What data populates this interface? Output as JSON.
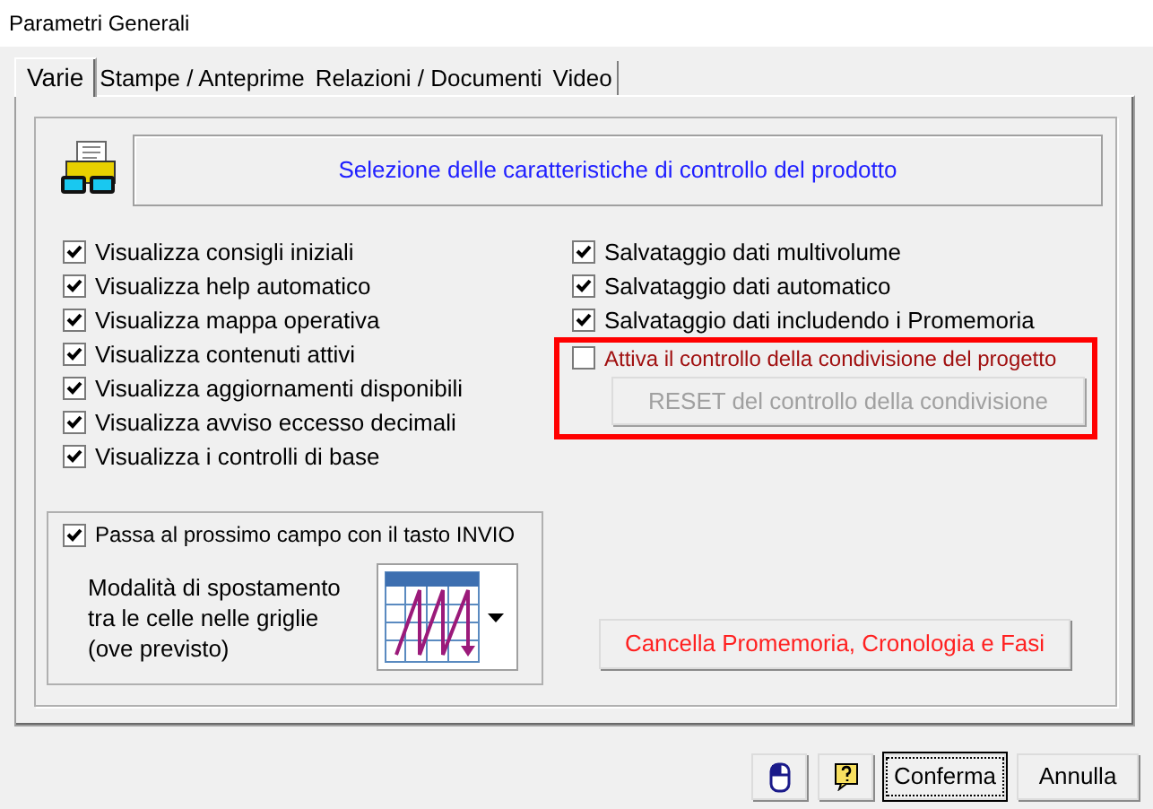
{
  "window": {
    "title": "Parametri Generali"
  },
  "tabs": [
    {
      "label": "Varie",
      "selected": true
    },
    {
      "label": "Stampe / Anteprime",
      "selected": false
    },
    {
      "label": "Relazioni / Documenti",
      "selected": false
    },
    {
      "label": "Video",
      "selected": false
    }
  ],
  "header": {
    "label": "Selezione delle caratteristiche di controllo del prodotto"
  },
  "left_options": [
    {
      "label": "Visualizza consigli iniziali",
      "checked": true
    },
    {
      "label": "Visualizza help automatico",
      "checked": true
    },
    {
      "label": "Visualizza mappa operativa",
      "checked": true
    },
    {
      "label": "Visualizza contenuti attivi",
      "checked": true
    },
    {
      "label": "Visualizza aggiornamenti disponibili",
      "checked": true
    },
    {
      "label": "Visualizza avviso eccesso decimali",
      "checked": true
    },
    {
      "label": "Visualizza i controlli di base",
      "checked": true
    }
  ],
  "right_options": [
    {
      "label": "Salvataggio dati multivolume",
      "checked": true
    },
    {
      "label": "Salvataggio dati automatico",
      "checked": true
    },
    {
      "label": "Salvataggio dati includendo i Promemoria",
      "checked": true
    }
  ],
  "sharing": {
    "label": "Attiva il controllo della condivisione del progetto",
    "checked": false,
    "reset_button": {
      "label": "RESET del controllo della condivisione",
      "disabled": true
    }
  },
  "enter_group": {
    "label": "Passa al prossimo campo con il tasto INVIO",
    "checked": true,
    "grid_mode_label": "Modalità di spostamento\ntra le celle nelle griglie\n(ove previsto)"
  },
  "clear_button": {
    "label": "Cancella Promemoria, Cronologia e Fasi"
  },
  "footer_buttons": [
    {
      "kind": "mouse",
      "focused": false
    },
    {
      "kind": "help",
      "focused": false
    },
    {
      "kind": "text",
      "label": "Conferma",
      "focused": true
    },
    {
      "kind": "text",
      "label": "Annulla",
      "focused": false
    }
  ]
}
